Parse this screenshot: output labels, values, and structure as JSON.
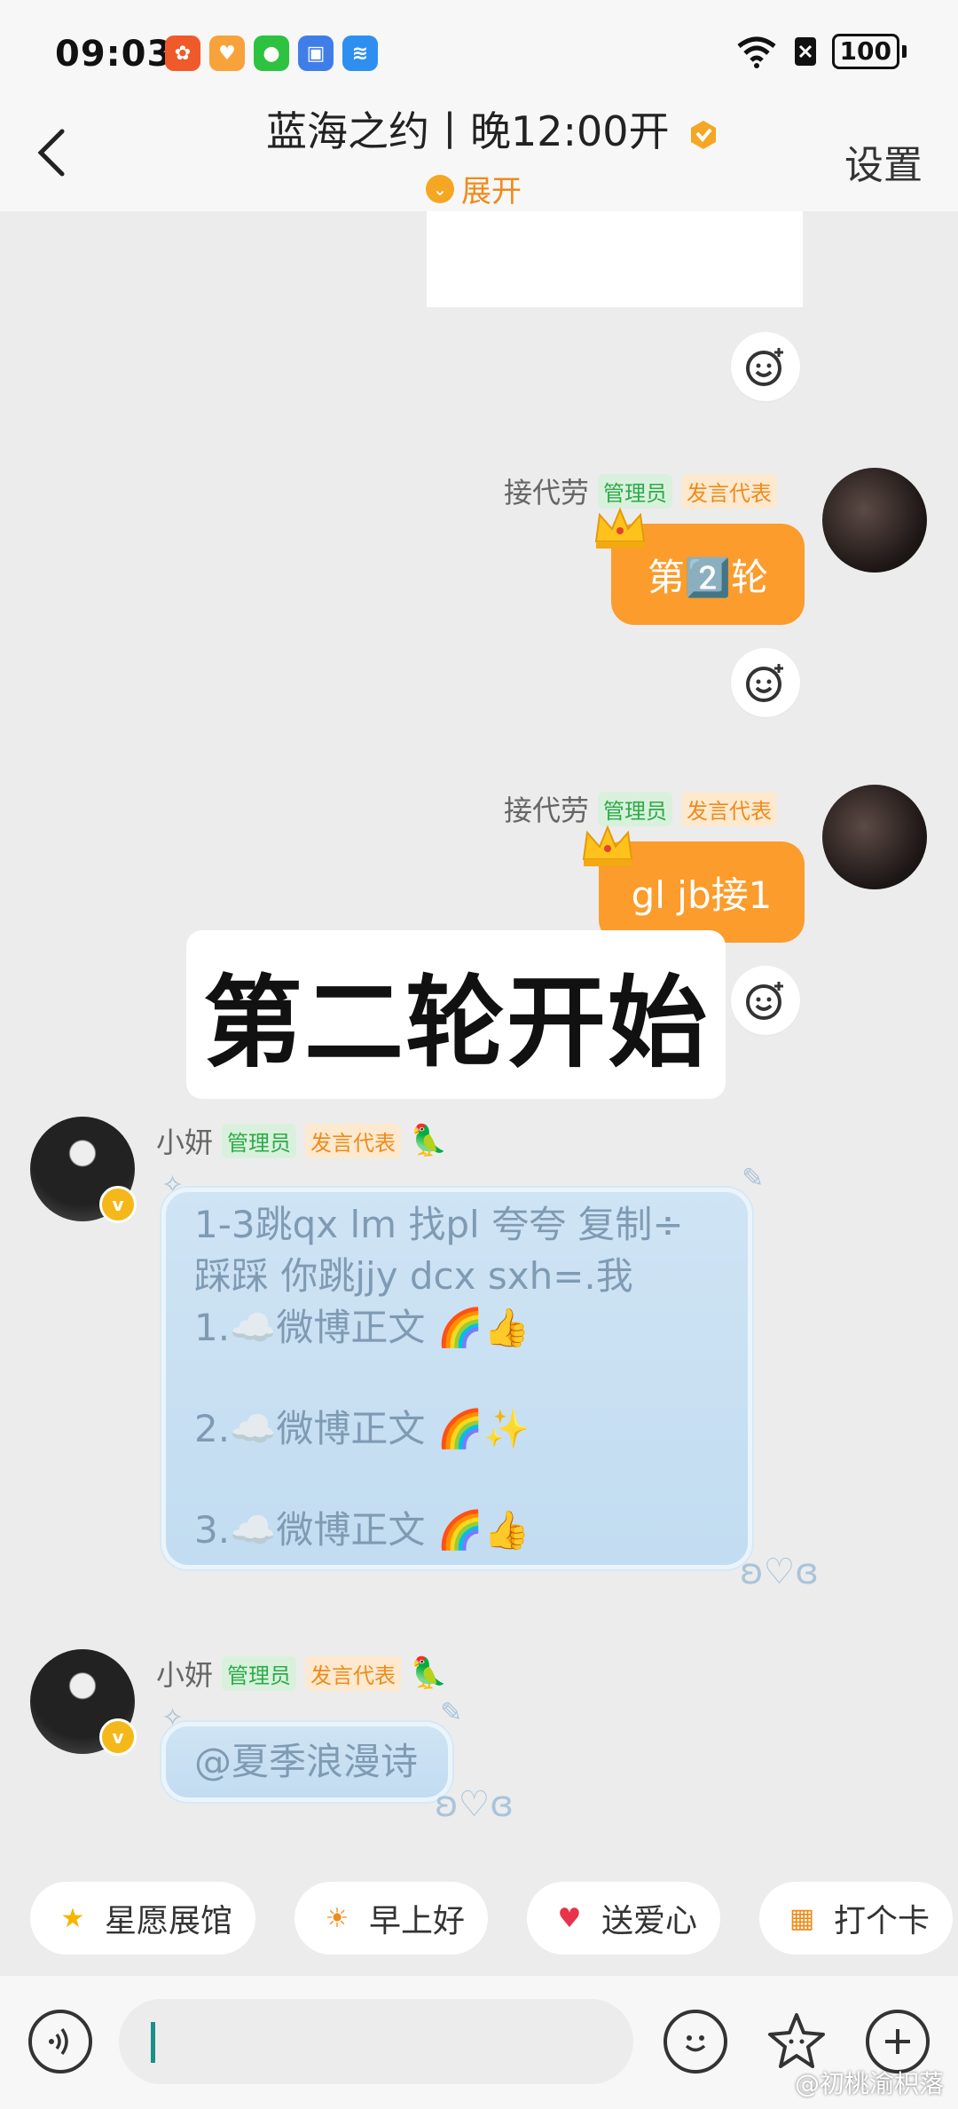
{
  "status_bar": {
    "time": "09:03",
    "battery": "100",
    "notification_icons": [
      "app-icon-orange",
      "app-icon-heart",
      "wechat-icon",
      "app-icon-blue",
      "app-icon-wifi-helper"
    ]
  },
  "header": {
    "title": "蓝海之约丨晚12:00开",
    "expand_label": "展开",
    "settings_label": "设置"
  },
  "messages": [
    {
      "sender": "接代劳",
      "tags": [
        "管理员",
        "发言代表"
      ],
      "text": "第2️⃣轮"
    },
    {
      "sender": "接代劳",
      "tags": [
        "管理员",
        "发言代表"
      ],
      "text": "gl jb接1"
    },
    {
      "banner": "第二轮开始"
    },
    {
      "sender": "小妍",
      "tags": [
        "管理员",
        "发言代表"
      ],
      "lines": [
        "1-3跳qx lm 找pl 夸夸 复制÷",
        "踩踩 你跳jjy dcx sxh=.我",
        "1.☁️微博正文 🌈👍",
        "",
        "2.☁️微博正文 🌈✨",
        "",
        "3.☁️微博正文 🌈👍"
      ]
    },
    {
      "sender": "小妍",
      "tags": [
        "管理员",
        "发言代表"
      ],
      "text": "@夏季浪漫诗"
    }
  ],
  "quick_replies": [
    {
      "label": "星愿展馆",
      "icon": "star-icon"
    },
    {
      "label": "早上好",
      "icon": "sun-face-icon"
    },
    {
      "label": "送爱心",
      "icon": "heart-icon"
    },
    {
      "label": "打个卡",
      "icon": "calendar-icon"
    }
  ],
  "input": {
    "placeholder": ""
  },
  "watermark": "@初桃渝枳落",
  "colors": {
    "accent_orange": "#fb9c2c",
    "admin_green": "#2daa4a",
    "bubble_blue": "#c9e0f3"
  }
}
